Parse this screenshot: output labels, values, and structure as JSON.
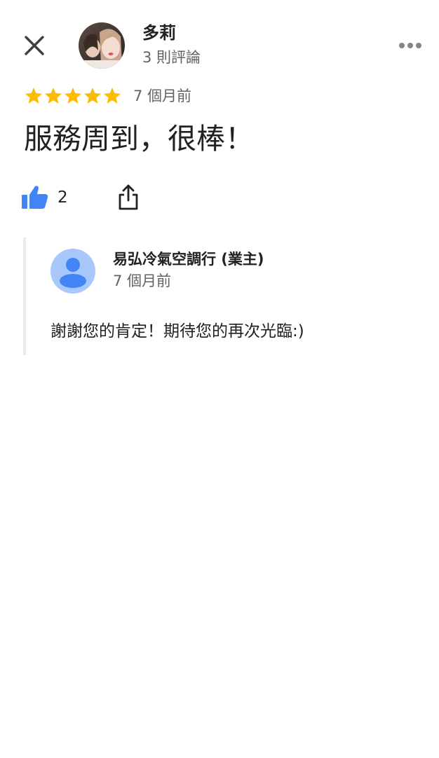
{
  "reviewer": {
    "name": "多莉",
    "review_count": "3 則評論"
  },
  "review": {
    "rating": 5,
    "max_rating": 5,
    "time": "7 個月前",
    "text": "服務周到，很棒！",
    "like_count": "2"
  },
  "owner_reply": {
    "name": "易弘冷氣空調行 (業主)",
    "time": "7 個月前",
    "text": "謝謝您的肯定！期待您的再次光臨:)"
  },
  "colors": {
    "star": "#fbbc04",
    "like": "#4285f4",
    "owner_avatar_bg": "#a8c7fa",
    "owner_avatar_fg": "#4285f4"
  },
  "icons": {
    "close": "close-icon",
    "more": "more-horizontal-icon",
    "like": "thumb-up-icon",
    "share": "share-icon",
    "star": "star-icon",
    "owner_avatar": "person-icon"
  }
}
